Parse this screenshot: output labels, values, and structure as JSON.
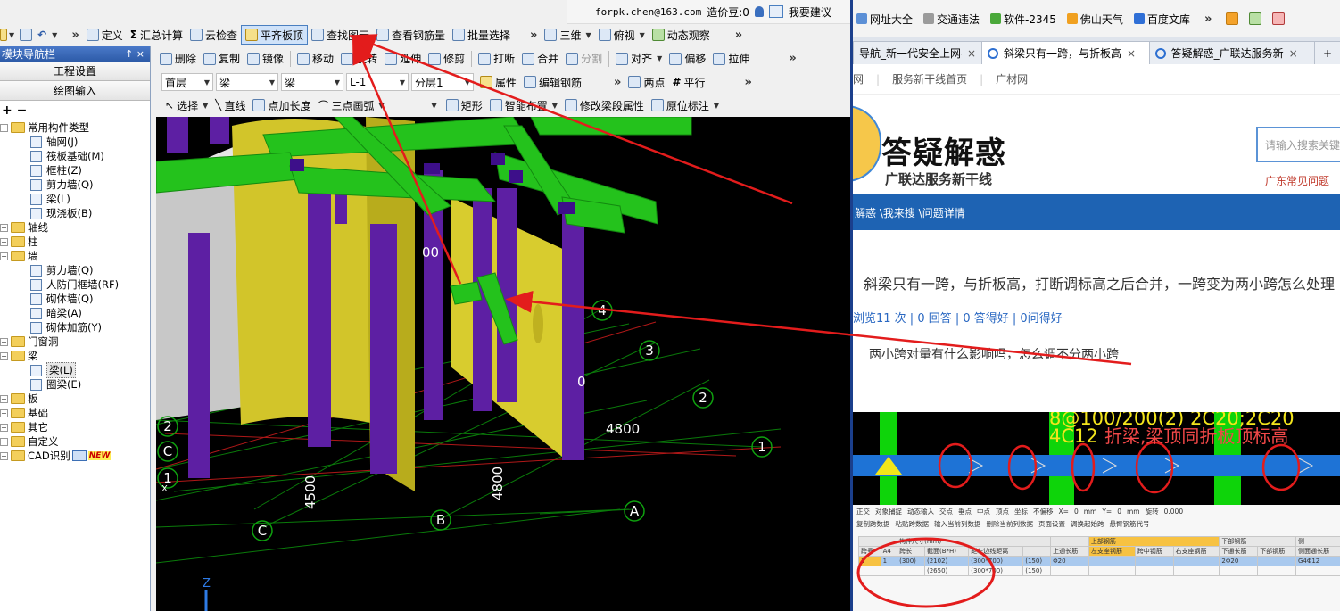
{
  "app": {
    "topbar": {
      "email": "forpk.chen@163.com",
      "price_label": "造价豆:0",
      "help_label": "我要建议"
    },
    "toolbar1": {
      "items": [
        "定义",
        "汇总计算",
        "云检查",
        "平齐板顶",
        "查找图元",
        "查看钢筋量",
        "批量选择"
      ],
      "right_items": [
        "三维",
        "俯视",
        "动态观察"
      ]
    },
    "toolbar2": {
      "items": [
        "删除",
        "复制",
        "镜像",
        "移动",
        "旋转",
        "延伸",
        "修剪",
        "打断",
        "合并",
        "分割",
        "对齐",
        "偏移",
        "拉伸"
      ]
    },
    "toolbar3": {
      "floor": "首层",
      "category": "梁",
      "type": "梁",
      "component": "L-1",
      "layer": "分层1",
      "items": [
        "属性",
        "编辑钢筋",
        "两点",
        "平行"
      ]
    },
    "toolbar4": {
      "items": [
        "选择",
        "直线",
        "点加长度",
        "三点画弧",
        "矩形",
        "智能布置",
        "修改梁段属性",
        "原位标注"
      ]
    },
    "nav": {
      "title": "模块导航栏",
      "pin_glyphs": "↑ ×",
      "btn_settings": "工程设置",
      "btn_draw": "绘图输入",
      "tree_tools": "+ −",
      "common_group": "常用构件类型",
      "common_items": [
        "轴网(J)",
        "筏板基础(M)",
        "框柱(Z)",
        "剪力墙(Q)",
        "梁(L)",
        "现浇板(B)"
      ],
      "group_axis": "轴线",
      "group_column": "柱",
      "group_wall": "墙",
      "wall_items": [
        "剪力墙(Q)",
        "人防门框墙(RF)",
        "砌体墙(Q)",
        "暗梁(A)",
        "砌体加筋(Y)"
      ],
      "group_door": "门窗洞",
      "group_beam": "梁",
      "beam_items": [
        "梁(L)",
        "圈梁(E)"
      ],
      "group_slab": "板",
      "group_foundation": "基础",
      "group_other": "其它",
      "group_custom": "自定义",
      "group_cad": "CAD识别",
      "new_badge": "NEW"
    },
    "viewport": {
      "axis_numbers": [
        "1",
        "2",
        "3",
        "4",
        "A",
        "B",
        "C",
        "C",
        "2",
        "1"
      ],
      "dimensions": [
        "4800",
        "4500",
        "4800",
        "00",
        "0"
      ],
      "z_label": "Z",
      "x_label": "X"
    }
  },
  "browser": {
    "bookmarks": [
      "网址大全",
      "交通违法",
      "软件-2345",
      "佛山天气",
      "百度文库"
    ],
    "tabs": [
      "导航_新一代安全上网导",
      "斜梁只有一跨，与折板高",
      "答疑解惑_广联达服务新"
    ],
    "site_nav": [
      "网",
      "服务新干线首页",
      "广材网"
    ],
    "logo_main": "答疑解惑",
    "logo_sub": "广联达服务新干线",
    "search_placeholder": "请输入搜索关键",
    "hot_link": "广东常见问题",
    "breadcrumb": "解惑 \\我来搜 \\问题详情",
    "question_title": "斜梁只有一跨，与折板高，打断调标高之后合并，一跨变为两小跨怎么处理",
    "stats": "浏览11 次 | 0 回答 | 0 答得好 | 0问得好",
    "question_body": "两小跨对量有什么影响吗，怎么调不分两小跨",
    "embed": {
      "rebar_text": "8@100/200(2) 2C20;2C20",
      "rebar_text2": "4C12",
      "annotation": "折梁,梁顶同折板顶标高",
      "tool_row1": [
        "正交",
        "对象捕捉",
        "动态输入",
        "交点",
        "垂点",
        "中点",
        "顶点",
        "坐标",
        "不偏移",
        "X=",
        "0",
        "mm",
        "Y=",
        "0",
        "mm",
        "旋转",
        "0.000"
      ],
      "tool_row2": [
        "复制跨数据",
        "粘贴跨数据",
        "输入当前列数据",
        "删除当前列数据",
        "页面设置",
        "调换起始跨",
        "悬臂钢筋代号"
      ],
      "table_headers": [
        "跨号",
        "A4",
        "跨长",
        "截面(B*H)",
        "距左边线距离",
        "上通长筋",
        "左支座钢筋",
        "跨中钢筋",
        "右支座钢筋",
        "下通长筋",
        "下部钢筋",
        "侧面通长筋",
        "侧面"
      ],
      "group_headers": [
        "构件尺寸(mm)",
        "上部钢筋",
        "下部钢筋",
        "侧"
      ],
      "row1": [
        "1",
        "1",
        "(300)",
        "(2102)",
        "(300*700)",
        "(150)",
        "Φ20",
        "",
        "",
        "",
        "2Φ20",
        "",
        "G4Φ12"
      ],
      "row2": [
        "",
        "",
        "",
        "(2650)",
        "(300*700)",
        "(150)"
      ]
    }
  }
}
